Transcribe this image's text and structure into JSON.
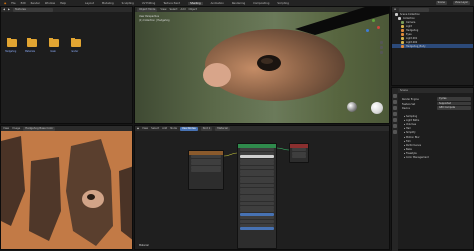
{
  "topbar": {
    "menus": [
      "File",
      "Edit",
      "Render",
      "Window",
      "Help"
    ],
    "workspaces": [
      "Layout",
      "Modeling",
      "Sculpting",
      "UV Editing",
      "Texture Paint",
      "Shading",
      "Animation",
      "Rendering",
      "Compositing",
      "Scripting"
    ],
    "active_workspace": "Shading",
    "scene": "Scene",
    "view_layer": "View Layer"
  },
  "filebrowser": {
    "path": "Textures",
    "folders": [
      "Hedgehog",
      "Materials",
      "mask",
      "render"
    ]
  },
  "viewport": {
    "mode": "Object Mode",
    "menus": [
      "View",
      "Select",
      "Add",
      "Object"
    ],
    "overlay_line1": "User Perspective",
    "overlay_line2": "(1) Collection | Hedgehog"
  },
  "outliner": {
    "title": "Scene Collection",
    "items": [
      "Collection",
      "Camera",
      "Light",
      "Hedgehog",
      "Eyes",
      "Light.001",
      "Light.002",
      "Hedgehog_Body"
    ],
    "selected_index": 7
  },
  "properties": {
    "title": "Scene",
    "fields": [
      {
        "label": "Render Engine",
        "value": "Cycles"
      },
      {
        "label": "Feature Set",
        "value": "Supported"
      },
      {
        "label": "Device",
        "value": "GPU Compute"
      }
    ],
    "sections": [
      "Sampling",
      "Light Paths",
      "Volumes",
      "Hair",
      "Simplify",
      "Motion Blur",
      "Film",
      "Performance",
      "Bake",
      "Freestyle",
      "Color Management"
    ]
  },
  "image_editor": {
    "image_name": "Hedgehog Base Color",
    "menus": [
      "View",
      "Image"
    ]
  },
  "node_editor": {
    "menus": [
      "View",
      "Select",
      "Add",
      "Node"
    ],
    "use_nodes": "Use Nodes",
    "slot": "Slot 1",
    "material": "Material",
    "footer": "Material"
  },
  "colors": {
    "accent": "#4772b3",
    "folder": "#e2a532",
    "selected": "#2c4a7a"
  }
}
